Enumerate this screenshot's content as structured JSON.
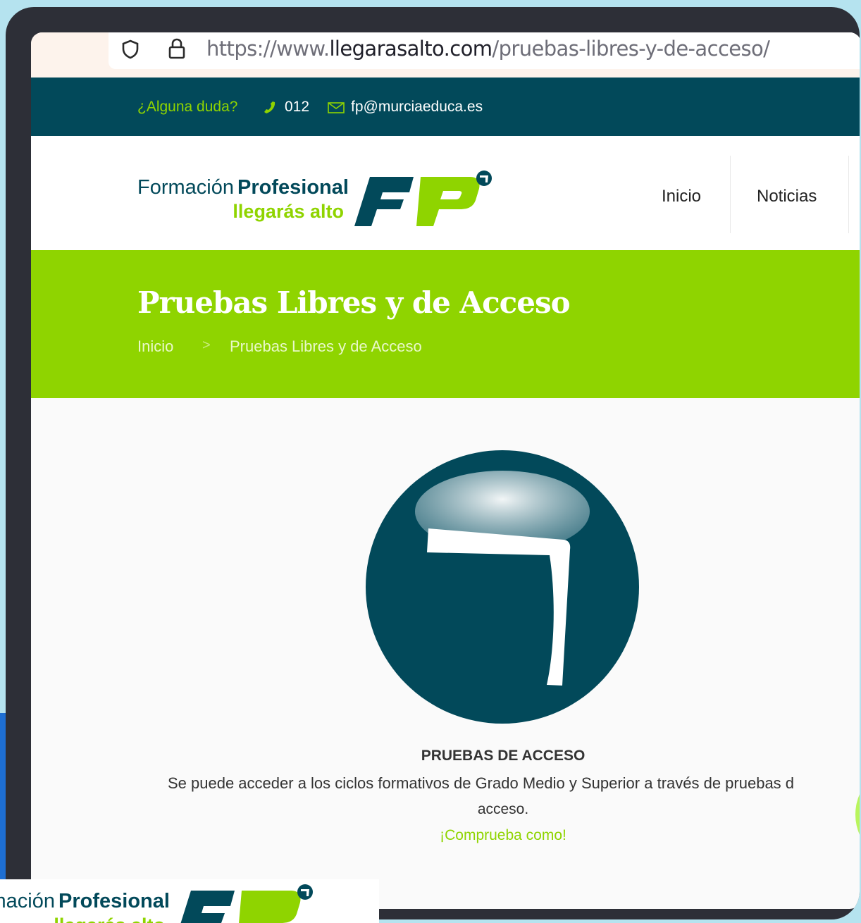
{
  "browser": {
    "url_prefix": "https://www.",
    "url_host": "llegarasalto.com",
    "url_path": "/pruebas-libres-y-de-acceso/"
  },
  "topbar": {
    "question": "¿Alguna duda?",
    "phone": "012",
    "email": "fp@murciaeduca.es"
  },
  "logo": {
    "word1": "Formación",
    "word2": "Profesional",
    "tagline": "llegarás alto",
    "mark": "FP"
  },
  "nav": {
    "items": [
      "Inicio",
      "Noticias"
    ]
  },
  "hero": {
    "title": "Pruebas Libres y de Acceso",
    "breadcrumb": [
      "Inicio",
      "Pruebas Libres y de Acceso"
    ],
    "separator": ">"
  },
  "content": {
    "heading": "PRUEBAS DE ACCESO",
    "description_line1": "Se puede acceder a los ciclos formativos de Grado Medio y Superior a través de pruebas d",
    "description_line2": "acceso.",
    "link": "¡Comprueba como!"
  },
  "colors": {
    "brand_green": "#8fd400",
    "brand_teal": "#02495a",
    "frame": "#2d2f37",
    "background": "#b5e3ef"
  }
}
